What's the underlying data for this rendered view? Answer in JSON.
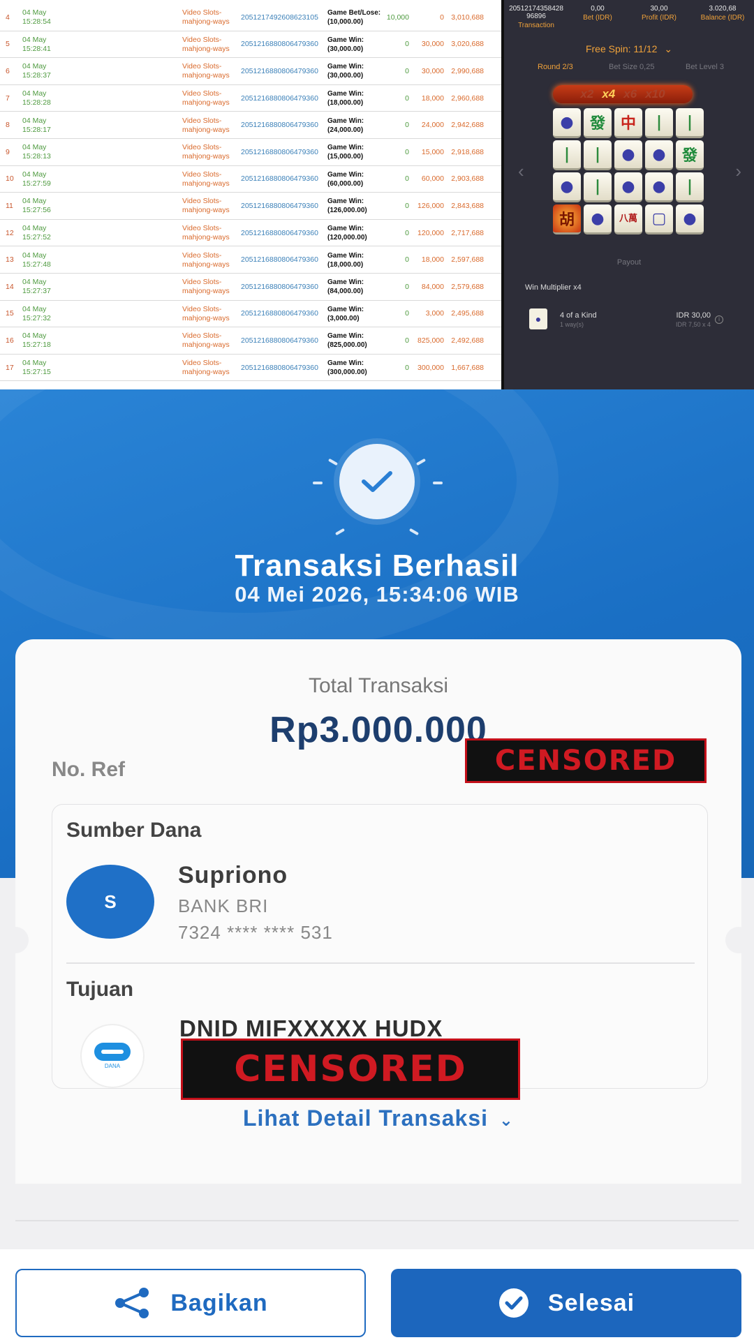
{
  "history": {
    "rows": [
      {
        "no": "4",
        "date": "04 May",
        "time": "15:28:54",
        "game": "Video Slots-mahjong-ways",
        "txn": "2051217492608623105",
        "type": "Game Bet/Lose:",
        "amt": "(10,000.00)",
        "bet": "10,000",
        "win": "0",
        "balance": "3,010,688"
      },
      {
        "no": "5",
        "date": "04 May",
        "time": "15:28:41",
        "game": "Video Slots-mahjong-ways",
        "txn": "2051216880806479360",
        "type": "Game Win:",
        "amt": "(30,000.00)",
        "bet": "0",
        "win": "30,000",
        "balance": "3,020,688"
      },
      {
        "no": "6",
        "date": "04 May",
        "time": "15:28:37",
        "game": "Video Slots-mahjong-ways",
        "txn": "2051216880806479360",
        "type": "Game Win:",
        "amt": "(30,000.00)",
        "bet": "0",
        "win": "30,000",
        "balance": "2,990,688"
      },
      {
        "no": "7",
        "date": "04 May",
        "time": "15:28:28",
        "game": "Video Slots-mahjong-ways",
        "txn": "2051216880806479360",
        "type": "Game Win:",
        "amt": "(18,000.00)",
        "bet": "0",
        "win": "18,000",
        "balance": "2,960,688"
      },
      {
        "no": "8",
        "date": "04 May",
        "time": "15:28:17",
        "game": "Video Slots-mahjong-ways",
        "txn": "2051216880806479360",
        "type": "Game Win:",
        "amt": "(24,000.00)",
        "bet": "0",
        "win": "24,000",
        "balance": "2,942,688"
      },
      {
        "no": "9",
        "date": "04 May",
        "time": "15:28:13",
        "game": "Video Slots-mahjong-ways",
        "txn": "2051216880806479360",
        "type": "Game Win:",
        "amt": "(15,000.00)",
        "bet": "0",
        "win": "15,000",
        "balance": "2,918,688"
      },
      {
        "no": "10",
        "date": "04 May",
        "time": "15:27:59",
        "game": "Video Slots-mahjong-ways",
        "txn": "2051216880806479360",
        "type": "Game Win:",
        "amt": "(60,000.00)",
        "bet": "0",
        "win": "60,000",
        "balance": "2,903,688"
      },
      {
        "no": "11",
        "date": "04 May",
        "time": "15:27:56",
        "game": "Video Slots-mahjong-ways",
        "txn": "2051216880806479360",
        "type": "Game Win:",
        "amt": "(126,000.00)",
        "bet": "0",
        "win": "126,000",
        "balance": "2,843,688"
      },
      {
        "no": "12",
        "date": "04 May",
        "time": "15:27:52",
        "game": "Video Slots-mahjong-ways",
        "txn": "2051216880806479360",
        "type": "Game Win:",
        "amt": "(120,000.00)",
        "bet": "0",
        "win": "120,000",
        "balance": "2,717,688"
      },
      {
        "no": "13",
        "date": "04 May",
        "time": "15:27:48",
        "game": "Video Slots-mahjong-ways",
        "txn": "2051216880806479360",
        "type": "Game Win:",
        "amt": "(18,000.00)",
        "bet": "0",
        "win": "18,000",
        "balance": "2,597,688"
      },
      {
        "no": "14",
        "date": "04 May",
        "time": "15:27:37",
        "game": "Video Slots-mahjong-ways",
        "txn": "2051216880806479360",
        "type": "Game Win:",
        "amt": "(84,000.00)",
        "bet": "0",
        "win": "84,000",
        "balance": "2,579,688"
      },
      {
        "no": "15",
        "date": "04 May",
        "time": "15:27:32",
        "game": "Video Slots-mahjong-ways",
        "txn": "2051216880806479360",
        "type": "Game Win:",
        "amt": "(3,000.00)",
        "bet": "0",
        "win": "3,000",
        "balance": "2,495,688"
      },
      {
        "no": "16",
        "date": "04 May",
        "time": "15:27:18",
        "game": "Video Slots-mahjong-ways",
        "txn": "2051216880806479360",
        "type": "Game Win:",
        "amt": "(825,000.00)",
        "bet": "0",
        "win": "825,000",
        "balance": "2,492,688"
      },
      {
        "no": "17",
        "date": "04 May",
        "time": "15:27:15",
        "game": "Video Slots-mahjong-ways",
        "txn": "2051216880806479360",
        "type": "Game Win:",
        "amt": "(300,000.00)",
        "bet": "0",
        "win": "300,000",
        "balance": "1,667,688"
      }
    ]
  },
  "game": {
    "summary": [
      {
        "value": "20512174358428 96896",
        "label": "Transaction"
      },
      {
        "value": "0,00",
        "label": "Bet (IDR)"
      },
      {
        "value": "30,00",
        "label": "Profit (IDR)"
      },
      {
        "value": "3.020,68",
        "label": "Balance (IDR)"
      }
    ],
    "free_spin": "Free Spin: 11/12",
    "round": "Round 2/3",
    "bet_size": "Bet Size 0,25",
    "bet_level": "Bet Level 3",
    "multipliers": [
      "x2",
      "x4",
      "x6",
      "x10"
    ],
    "active_multiplier": "x4",
    "tiles": [
      [
        "●",
        "發",
        "中",
        "|",
        "|"
      ],
      [
        "|",
        "|",
        "●",
        "●",
        "發"
      ],
      [
        "●",
        "|",
        "●",
        "●",
        "|"
      ],
      [
        "胡",
        "●",
        "八萬",
        "▢",
        "●"
      ]
    ],
    "payout_label": "Payout",
    "win_multiplier": "Win Multiplier x4",
    "pay_item": {
      "name": "4 of a Kind",
      "ways": "1 way(s)",
      "amount": "IDR 30,00",
      "calc": "IDR 7,50 x 4"
    },
    "colors": {
      "accent": "#f0a23a",
      "panel": "#2d2d38"
    }
  },
  "receipt": {
    "title": "Transaksi Berhasil",
    "datetime": "04 Mei 2026, 15:34:06 WIB",
    "total_label": "Total Transaksi",
    "total_value": "Rp3.000.000",
    "ref_label": "No. Ref",
    "censor_text": "CENSORED",
    "source_head": "Sumber Dana",
    "source_initial": "S",
    "source_name": "Supriono",
    "source_bank": "BANK BRI",
    "source_account": "7324 **** **** 531",
    "dest_head": "Tujuan",
    "dest_logo_label": "DANA",
    "dest_name": "DNID MIFXXXXX HUDX",
    "detail_link": "Lihat Detail Transaksi",
    "share_label": "Bagikan",
    "done_label": "Selesai",
    "colors": {
      "brand": "#1f6ac0",
      "header": "#2a84d6",
      "censor": "#d01a22"
    }
  }
}
